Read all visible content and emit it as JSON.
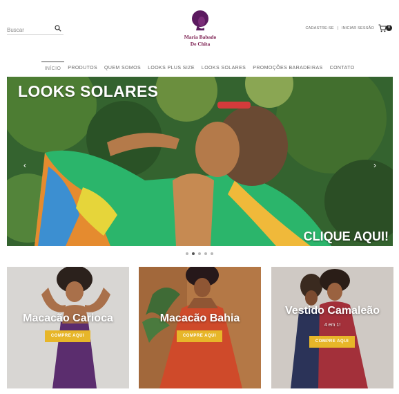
{
  "search": {
    "placeholder": "Buscar"
  },
  "logo": {
    "line1": "Maria Babado",
    "line2": "De Chita"
  },
  "account": {
    "signup": "CADASTRE-SE",
    "separator": "|",
    "login": "INICIAR SESSÃO"
  },
  "cart": {
    "count": "0"
  },
  "nav": {
    "items": [
      {
        "label": "INÍCIO"
      },
      {
        "label": "PRODUTOS"
      },
      {
        "label": "QUEM SOMOS"
      },
      {
        "label": "LOOKS PLUS SIZE"
      },
      {
        "label": "LOOKS SOLARES"
      },
      {
        "label": "PROMOÇÕES BARADEIRAS"
      },
      {
        "label": "CONTATO"
      }
    ]
  },
  "hero": {
    "title": "LOOKS SOLARES",
    "cta": "CLIQUE AQUI!",
    "prev": "‹",
    "next": "›"
  },
  "slider": {
    "slides": 5,
    "active": 2
  },
  "cards": [
    {
      "title": "Macacão Carioca",
      "button": "COMPRE AQUI"
    },
    {
      "title": "Macacão Bahia",
      "button": "COMPRE AQUI"
    },
    {
      "title": "Vestido Camaleão",
      "subtitle": "4 em 1!",
      "button": "COMPRE AQUI"
    }
  ],
  "colors": {
    "brand": "#7a1b4e",
    "button": "#e7b629"
  }
}
